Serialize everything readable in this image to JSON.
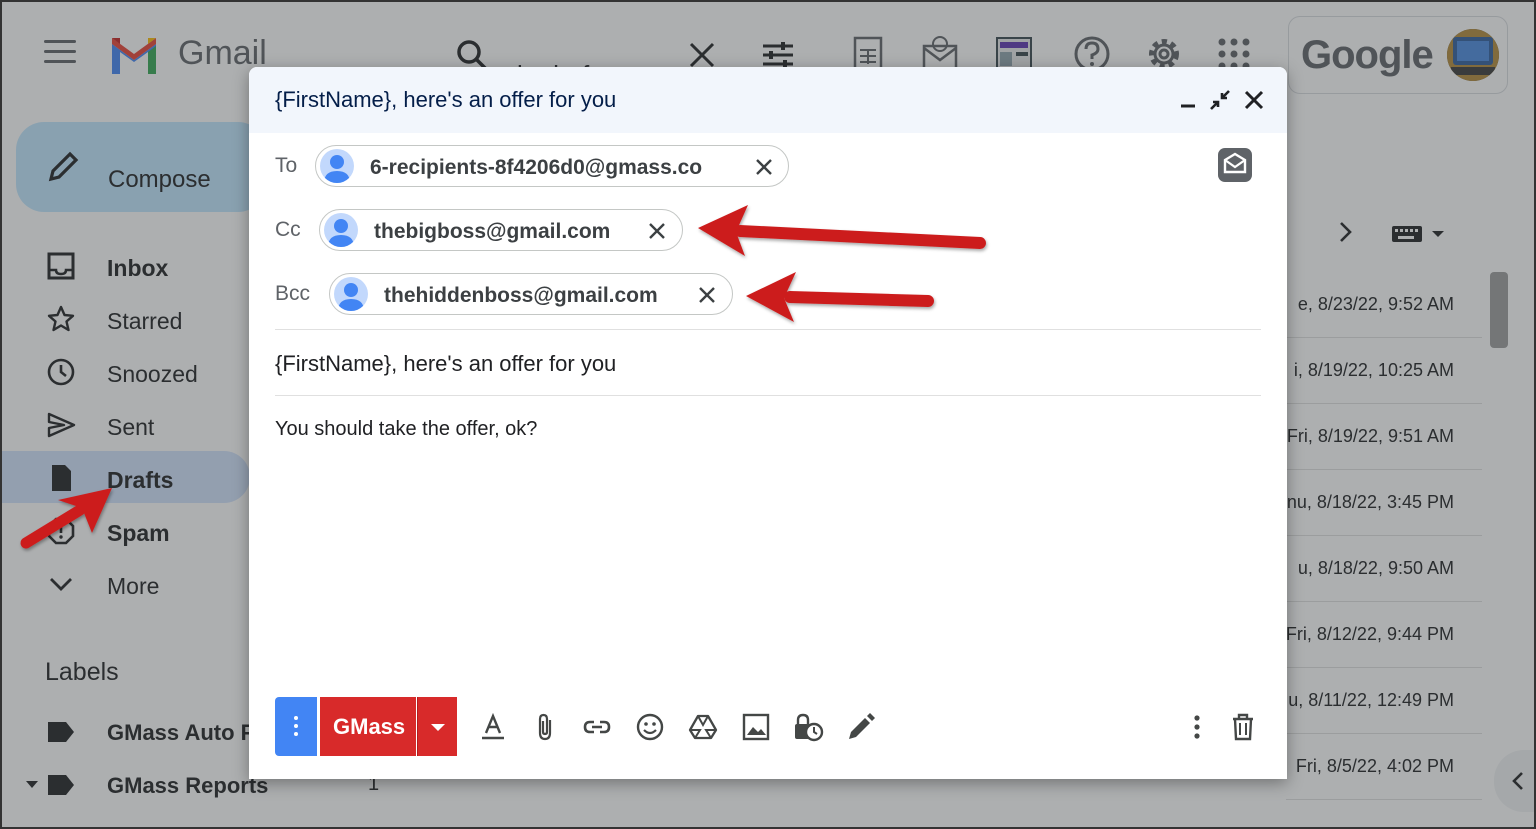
{
  "app": {
    "product_name": "Gmail",
    "google_wordmark": "Google",
    "search": {
      "query": "in:draft"
    },
    "sidebar": {
      "compose_label": "Compose",
      "items": [
        {
          "label": "Inbox",
          "icon": "inbox-icon"
        },
        {
          "label": "Starred",
          "icon": "star-icon"
        },
        {
          "label": "Snoozed",
          "icon": "clock-icon"
        },
        {
          "label": "Sent",
          "icon": "send-icon"
        },
        {
          "label": "Drafts",
          "icon": "draft-icon",
          "active": true
        },
        {
          "label": "Spam",
          "icon": "spam-icon"
        },
        {
          "label": "More",
          "icon": "chevron-down-icon"
        }
      ],
      "labels_heading": "Labels",
      "labels": [
        {
          "label": "GMass Auto F",
          "count": ""
        },
        {
          "label": "GMass Reports",
          "count": "1"
        }
      ]
    },
    "list_dates": [
      "e, 8/23/22, 9:52 AM",
      "i, 8/19/22, 10:25 AM",
      "Fri, 8/19/22, 9:51 AM",
      "nu, 8/18/22, 3:45 PM",
      "u, 8/18/22, 9:50 AM",
      "Fri, 8/12/22, 9:44 PM",
      "u, 8/11/22, 12:49 PM",
      "Fri, 8/5/22, 4:02 PM"
    ]
  },
  "compose": {
    "title": "{FirstName}, here's an offer for you",
    "to_label": "To",
    "to_recipient": "6-recipients-8f4206d0@gmass.co",
    "cc_label": "Cc",
    "cc_recipient": "thebigboss@gmail.com",
    "bcc_label": "Bcc",
    "bcc_recipient": "thehiddenboss@gmail.com",
    "subject": "{FirstName}, here's an offer for you",
    "body": "You should take the offer, ok?",
    "send_label": "GMass"
  },
  "colors": {
    "gmass_red": "#d82a2a",
    "accent_blue": "#4285f4",
    "annotation_arrow": "#cc1f1f"
  }
}
